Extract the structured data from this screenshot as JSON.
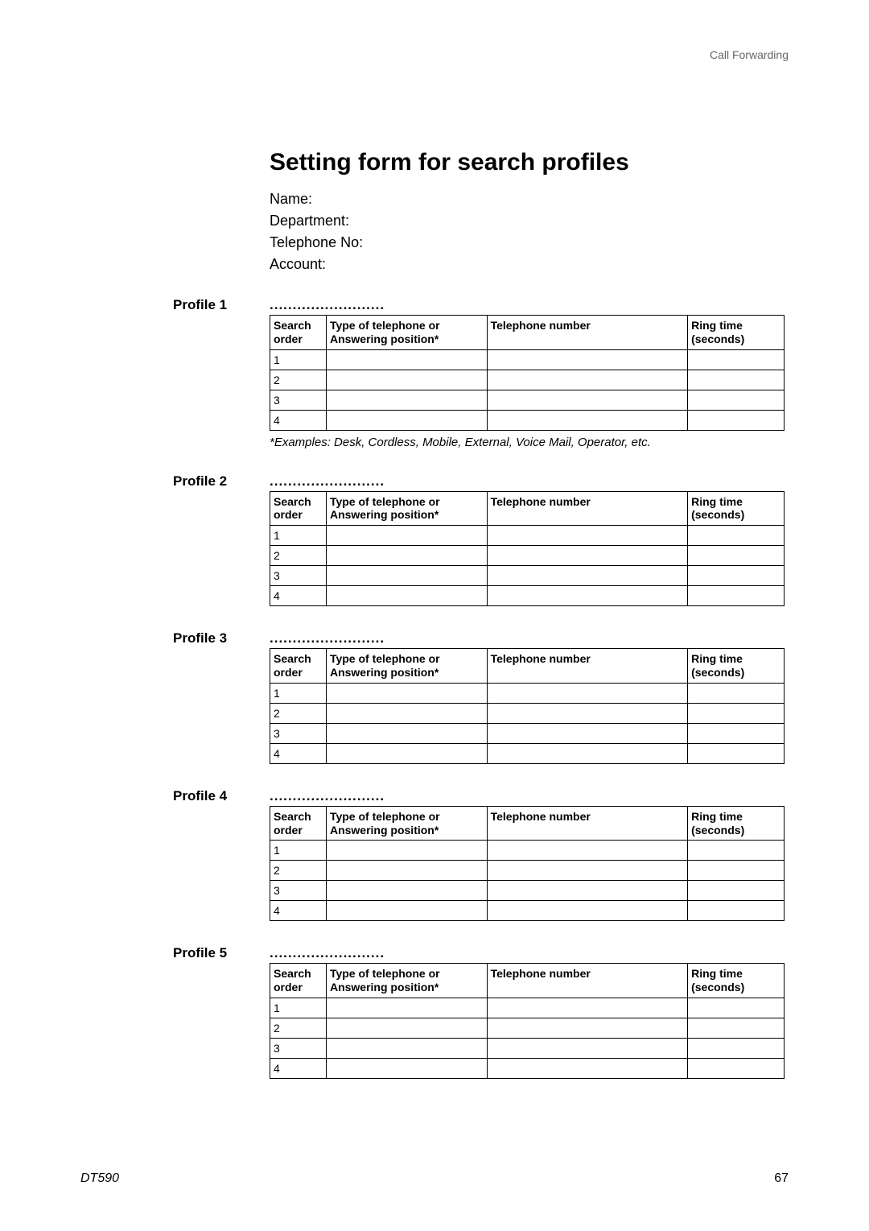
{
  "header": {
    "section": "Call Forwarding"
  },
  "title": "Setting form for search profiles",
  "fields": {
    "name": "Name:",
    "department": "Department:",
    "telephone": "Telephone No:",
    "account": "Account:"
  },
  "dotted": ".........................",
  "headers": {
    "search_order": "Search order",
    "type": "Type of telephone or Answering position*",
    "tel_number": "Telephone number",
    "ring_time": "Ring time (seconds)"
  },
  "rows": [
    "1",
    "2",
    "3",
    "4"
  ],
  "profiles": [
    {
      "label": "Profile 1",
      "has_footnote": true
    },
    {
      "label": "Profile 2",
      "has_footnote": false
    },
    {
      "label": "Profile 3",
      "has_footnote": false
    },
    {
      "label": "Profile 4",
      "has_footnote": false
    },
    {
      "label": "Profile 5",
      "has_footnote": false
    }
  ],
  "footnote": "*Examples: Desk, Cordless, Mobile, External, Voice Mail, Operator, etc.",
  "footer": {
    "left": "DT590",
    "right": "67"
  }
}
